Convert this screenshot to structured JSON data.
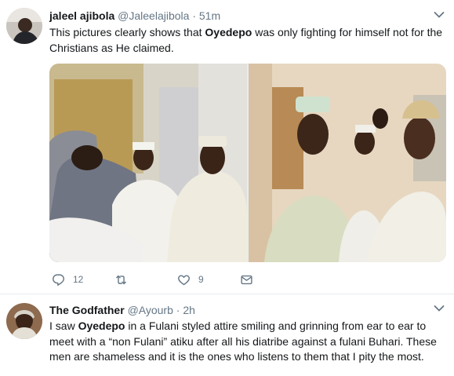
{
  "tweets": [
    {
      "display_name": "jaleel ajibola",
      "handle": "@Jaleelajibola",
      "separator": "·",
      "time": "51m",
      "text_parts": [
        "This pictures clearly shows that ",
        "Oyedepo",
        " was only fighting for himself not for the Christians as He claimed."
      ],
      "reply_count": "12",
      "retweet_count": "",
      "like_count": "9",
      "icons": [
        "reply-icon",
        "retweet-icon",
        "heart-icon",
        "envelope-icon",
        "chevron-down-icon"
      ]
    },
    {
      "display_name": "The Godfather",
      "handle": "@Ayourb",
      "separator": "·",
      "time": "2h",
      "text_parts": [
        "I saw ",
        "Oyedepo",
        " in a Fulani styled attire smiling and grinning from ear to ear to meet with a “non Fulani” atiku after all his diatribe against a fulani Buhari. These men are shameless and it is the ones who listens to them that I pity the most."
      ]
    }
  ],
  "colors": {
    "text": "#14171a",
    "muted": "#657786",
    "divider": "#e6ecf0"
  }
}
